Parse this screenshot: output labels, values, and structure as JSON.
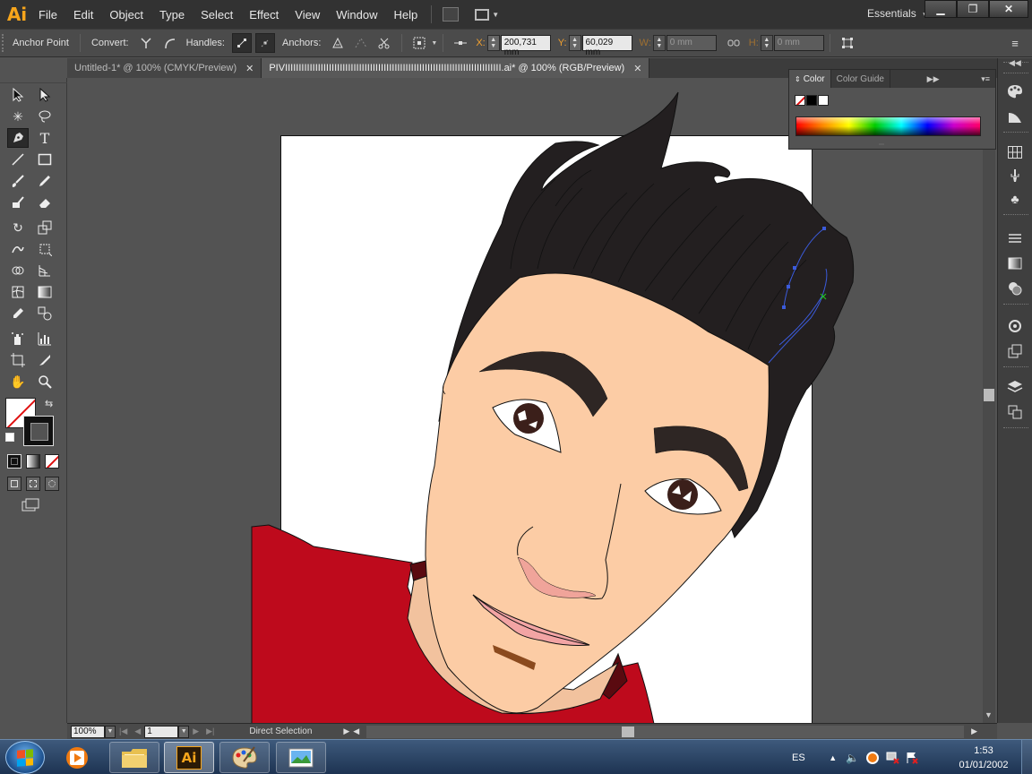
{
  "app": {
    "logo": "Ai",
    "menu": [
      "File",
      "Edit",
      "Object",
      "Type",
      "Select",
      "Effect",
      "View",
      "Window",
      "Help"
    ],
    "workspace": "Essentials",
    "window_controls": [
      "minimize-icon",
      "restore-icon",
      "close-icon"
    ]
  },
  "control_bar": {
    "tool_name": "Anchor Point",
    "convert_label": "Convert:",
    "handles_label": "Handles:",
    "anchors_label": "Anchors:",
    "x_label": "X:",
    "x_value": "200,731 mm",
    "y_label": "Y:",
    "y_value": "60,029 mm",
    "w_label": "W:",
    "w_value": "0 mm",
    "h_label": "H:",
    "h_value": "0 mm"
  },
  "tabs": [
    {
      "label": "Untitled-1* @ 100% (CMYK/Preview)",
      "active": false
    },
    {
      "label": "PIVIIIIIIIIIIIIIIIIIIIIIIIIIIIIIIIIIIIIIIIIIIIIIIIIIIIIIIIIIIIIIIIIIIIIIIIIIIIIIII.ai* @ 100% (RGB/Preview)",
      "active": true
    }
  ],
  "toolbox": {
    "tools": [
      "selection-tool-icon",
      "direct-selection-tool-icon",
      "magic-wand-tool-icon",
      "lasso-tool-icon",
      "pen-tool-icon",
      "type-tool-icon",
      "line-tool-icon",
      "rectangle-tool-icon",
      "paintbrush-tool-icon",
      "pencil-tool-icon",
      "blob-brush-tool-icon",
      "eraser-tool-icon",
      "rotate-tool-icon",
      "scale-tool-icon",
      "warp-tool-icon",
      "free-transform-tool-icon",
      "shape-builder-tool-icon",
      "perspective-grid-tool-icon",
      "mesh-tool-icon",
      "gradient-tool-icon",
      "eyedropper-tool-icon",
      "blend-tool-icon",
      "symbol-sprayer-tool-icon",
      "column-graph-tool-icon",
      "artboard-tool-icon",
      "slice-tool-icon",
      "hand-tool-icon",
      "zoom-tool-icon"
    ],
    "active_tool": "pen-tool-icon"
  },
  "color_panel": {
    "tabs": [
      "Color",
      "Color Guide"
    ],
    "active_tab": "Color",
    "swatches": [
      "#ffffff",
      "#000000",
      "#ffffff"
    ]
  },
  "status": {
    "zoom": "100%",
    "page": "1",
    "tool_status": "Direct Selection"
  },
  "artwork": {
    "colors": {
      "hair": "#231f20",
      "skin": "#fccca5",
      "skin_shadow": "#f2c29e",
      "shirt": "#be0a1c",
      "collar_dark": "#5a0a10",
      "brow": "#2e2624",
      "iris": "#3b1f1a",
      "lip": "#f2a4a4",
      "nose_shadow": "#f0a49a",
      "chin": "#8b4a1e",
      "path_highlight": "#3b5bdb"
    }
  },
  "taskbar": {
    "language": "ES",
    "time": "1:53",
    "date": "01/01/2002",
    "apps": [
      "media-player-icon",
      "file-explorer-icon",
      "illustrator-icon",
      "paint-icon",
      "image-viewer-icon"
    ],
    "active_app": "illustrator-icon"
  }
}
